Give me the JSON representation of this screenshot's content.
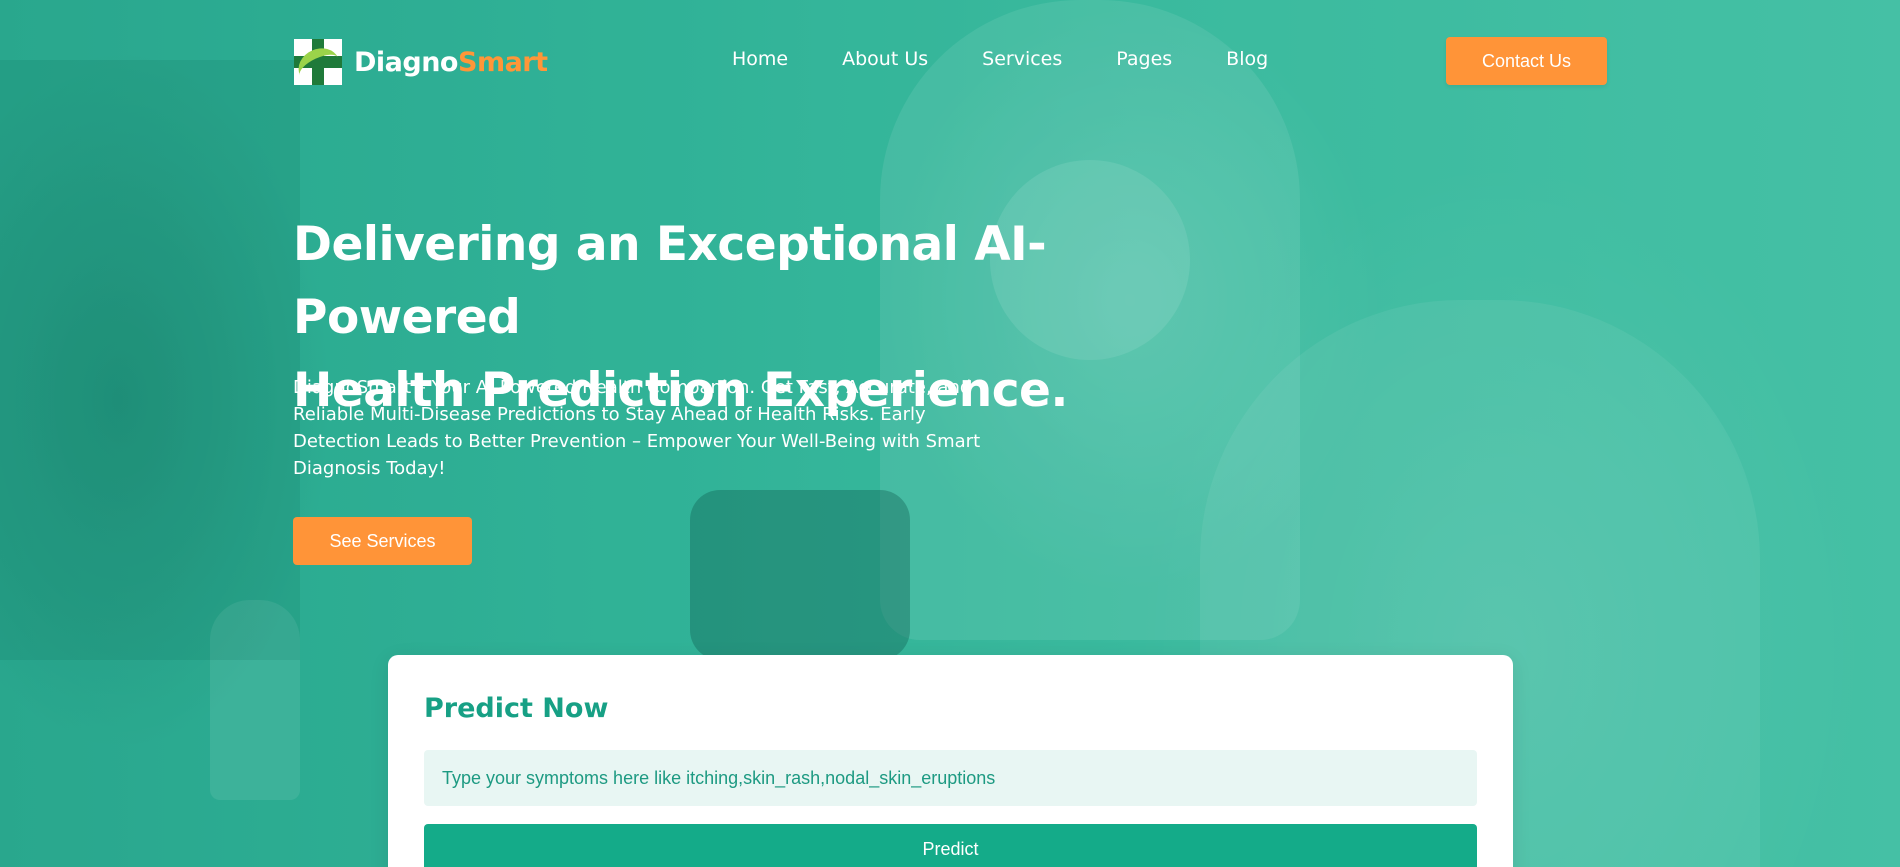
{
  "brand": {
    "name_part1": "Diagno",
    "name_part2": "Smart",
    "logo_icon": "medical-cross-logo-icon",
    "colors": {
      "primary": "#17a085",
      "accent": "#ff9438"
    }
  },
  "nav": {
    "items": [
      {
        "label": "Home"
      },
      {
        "label": "About Us"
      },
      {
        "label": "Services"
      },
      {
        "label": "Pages"
      },
      {
        "label": "Blog"
      }
    ],
    "cta_label": "Contact Us"
  },
  "hero": {
    "title_line1": "Delivering an Exceptional AI-Powered",
    "title_line2": "Health Prediction Experience.",
    "description": "DiagnoSmart – Your AI-Powered Health Companion. Get Fast, Accurate, and Reliable Multi-Disease Predictions to Stay Ahead of Health Risks. Early Detection Leads to Better Prevention – Empower Your Well-Being with Smart Diagnosis Today!",
    "button_label": "See Services"
  },
  "predict": {
    "title": "Predict Now",
    "input_placeholder": "Type your symptoms here like itching,skin_rash,nodal_skin_eruptions",
    "input_value": "",
    "button_label": "Predict"
  }
}
